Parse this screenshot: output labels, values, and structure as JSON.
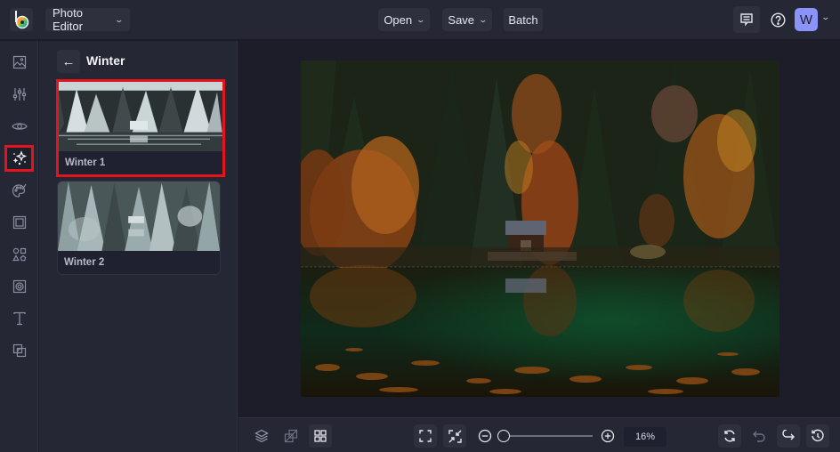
{
  "app": {
    "logo_icon": "befunky-logo-icon",
    "menu_label": "Photo Editor"
  },
  "toolbar": {
    "open_label": "Open",
    "save_label": "Save",
    "batch_label": "Batch",
    "comment_icon": "comment-icon",
    "help_icon": "help-icon",
    "avatar_initial": "W"
  },
  "sidebar": {
    "items": [
      {
        "name": "image-manager",
        "icon": "image-icon",
        "active": false
      },
      {
        "name": "edit",
        "icon": "sliders-icon",
        "active": false
      },
      {
        "name": "touch-up",
        "icon": "eye-icon",
        "active": false
      },
      {
        "name": "effects",
        "icon": "sparkles-icon",
        "active": true
      },
      {
        "name": "artsy",
        "icon": "palette-icon",
        "active": false
      },
      {
        "name": "frames",
        "icon": "frame-icon",
        "active": false
      },
      {
        "name": "graphics",
        "icon": "shapes-icon",
        "active": false
      },
      {
        "name": "overlays",
        "icon": "overlay-icon",
        "active": false
      },
      {
        "name": "text",
        "icon": "text-icon",
        "active": false
      },
      {
        "name": "textures",
        "icon": "texture-icon",
        "active": false
      }
    ]
  },
  "panel": {
    "title": "Winter",
    "effects": [
      {
        "label": "Winter 1",
        "selected": true
      },
      {
        "label": "Winter 2",
        "selected": false
      }
    ]
  },
  "bottombar": {
    "zoom_value": "16%",
    "zoom_fraction": 0.0
  }
}
